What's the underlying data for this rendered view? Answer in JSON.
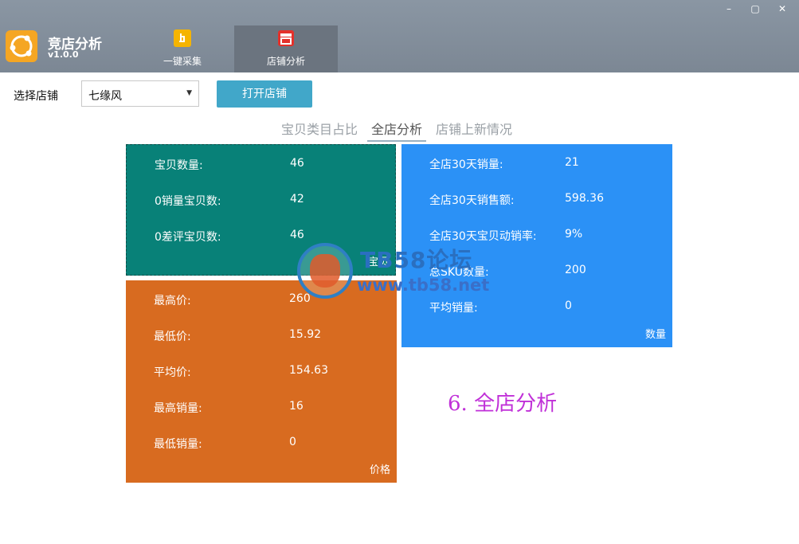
{
  "app": {
    "title": "竞店分析",
    "version": "v1.0.0"
  },
  "nav": {
    "tabs": [
      {
        "label": "一键采集"
      },
      {
        "label": "店铺分析"
      }
    ]
  },
  "window_controls": {
    "minimize": "–",
    "maximize": "▢",
    "close": "✕"
  },
  "toolbar": {
    "store_label": "选择店铺",
    "store_value": "七缘风",
    "open_button": "打开店铺"
  },
  "subtabs": [
    {
      "label": "宝贝类目占比"
    },
    {
      "label": "全店分析"
    },
    {
      "label": "店铺上新情况"
    }
  ],
  "panels": {
    "items": {
      "caption": "宝贝",
      "rows": [
        {
          "label": "宝贝数量:",
          "value": "46"
        },
        {
          "label": "0销量宝贝数:",
          "value": "42"
        },
        {
          "label": "0差评宝贝数:",
          "value": "46"
        }
      ]
    },
    "quantity": {
      "caption": "数量",
      "rows": [
        {
          "label": "全店30天销量:",
          "value": "21"
        },
        {
          "label": "全店30天销售额:",
          "value": "598.36"
        },
        {
          "label": "全店30天宝贝动销率:",
          "value": "9%"
        },
        {
          "label": "总SKU数量:",
          "value": "200"
        },
        {
          "label": "平均销量:",
          "value": "0"
        }
      ]
    },
    "price": {
      "caption": "价格",
      "rows": [
        {
          "label": "最高价:",
          "value": "260"
        },
        {
          "label": "最低价:",
          "value": "15.92"
        },
        {
          "label": "平均价:",
          "value": "154.63"
        },
        {
          "label": "最高销量:",
          "value": "16"
        },
        {
          "label": "最低销量:",
          "value": "0"
        }
      ]
    }
  },
  "watermark": {
    "title": "TB58论坛",
    "url": "www.tb58.net"
  },
  "caption": "6. 全店分析",
  "colors": {
    "titlebar": "#7c8794",
    "accent_button": "#41a7c9",
    "panel_teal": "#088178",
    "panel_blue": "#2b91f6",
    "panel_orange": "#d86b20",
    "caption_text": "#c030d8"
  }
}
